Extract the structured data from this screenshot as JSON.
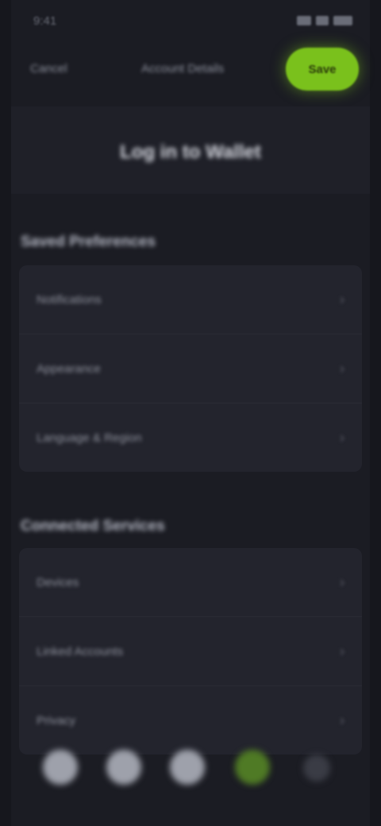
{
  "status_bar": {
    "time": "9:41"
  },
  "top_bar": {
    "left_link": "Cancel",
    "mid_link": "Account Details",
    "go_button": "Save"
  },
  "hero": {
    "title": "Log in to Wallet"
  },
  "section1": {
    "title": "Saved Preferences",
    "rows": [
      {
        "label": "Notifications"
      },
      {
        "label": "Appearance"
      },
      {
        "label": "Language & Region"
      }
    ]
  },
  "section2": {
    "title": "Connected Services",
    "rows": [
      {
        "label": "Devices"
      },
      {
        "label": "Linked Accounts"
      },
      {
        "label": "Privacy"
      }
    ]
  },
  "chevron": "›",
  "colors": {
    "accent": "#7ac11c",
    "background": "#1b1c23",
    "card": "#23242d"
  },
  "dock_icons": [
    "home-icon",
    "search-icon",
    "wallet-icon",
    "activity-icon",
    "more-icon"
  ]
}
